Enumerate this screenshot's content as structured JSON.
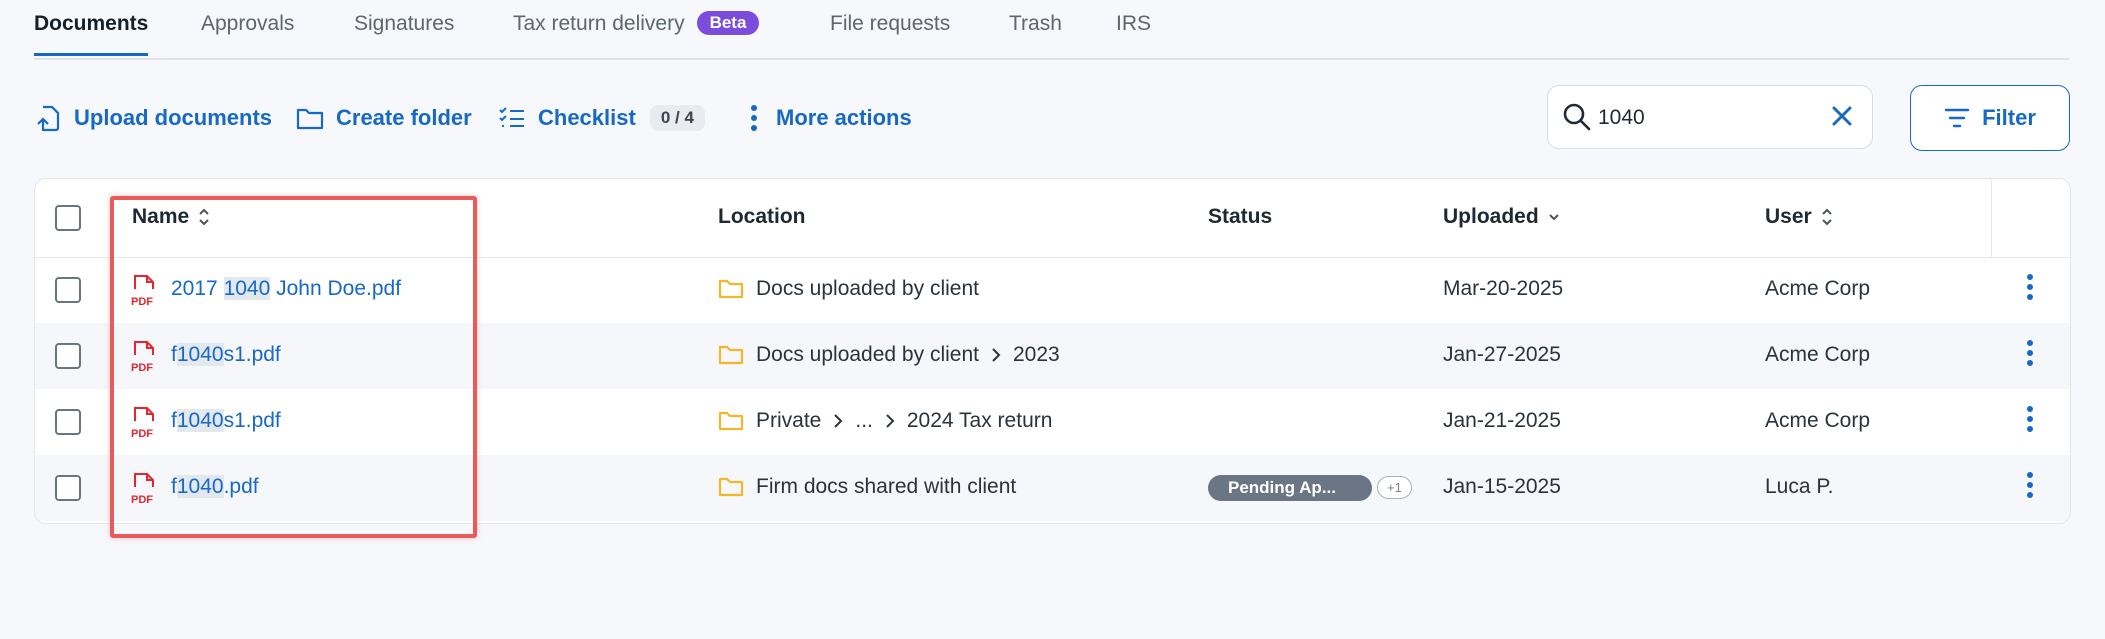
{
  "tabs": [
    {
      "label": "Documents",
      "active": true
    },
    {
      "label": "Approvals"
    },
    {
      "label": "Signatures"
    },
    {
      "label": "Tax return delivery",
      "badge": "Beta"
    },
    {
      "label": "File requests"
    },
    {
      "label": "Trash"
    },
    {
      "label": "IRS"
    }
  ],
  "toolbar": {
    "upload_label": "Upload documents",
    "create_folder_label": "Create folder",
    "checklist_label": "Checklist",
    "checklist_count": "0 / 4",
    "more_actions_label": "More actions",
    "filter_label": "Filter"
  },
  "search": {
    "value": "1040"
  },
  "table": {
    "columns": {
      "name": "Name",
      "location": "Location",
      "status": "Status",
      "uploaded": "Uploaded",
      "user": "User"
    },
    "rows": [
      {
        "name_pre": "2017 ",
        "name_hl": "1040",
        "name_post": " John Doe.pdf",
        "loc_1": "Docs uploaded by client",
        "date": "Mar-20-2025",
        "user": "Acme Corp"
      },
      {
        "name_pre": "f",
        "name_hl": "1040",
        "name_post": "s1.pdf",
        "loc_1": "Docs uploaded by client",
        "loc_2": "2023",
        "date": "Jan-27-2025",
        "user": "Acme Corp"
      },
      {
        "name_pre": "f",
        "name_hl": "1040",
        "name_post": "s1.pdf",
        "loc_1": "Private",
        "loc_2": "...",
        "loc_3": "2024 Tax return",
        "date": "Jan-21-2025",
        "user": "Acme Corp"
      },
      {
        "name_pre": "f",
        "name_hl": "1040",
        "name_post": ".pdf",
        "loc_1": "Firm docs shared with client",
        "status": "Pending Ap...",
        "status_extra": "+1",
        "date": "Jan-15-2025",
        "user": "Luca P."
      }
    ]
  },
  "icons": {
    "pdf_label": "PDF"
  },
  "colors": {
    "accent": "#1769c4",
    "beta_badge": "#7c4ddc",
    "pdf_red": "#e5262e",
    "folder_yellow": "#f2b82a",
    "highlight_box": "#e95a5a",
    "status_pill": "#6b7685"
  }
}
